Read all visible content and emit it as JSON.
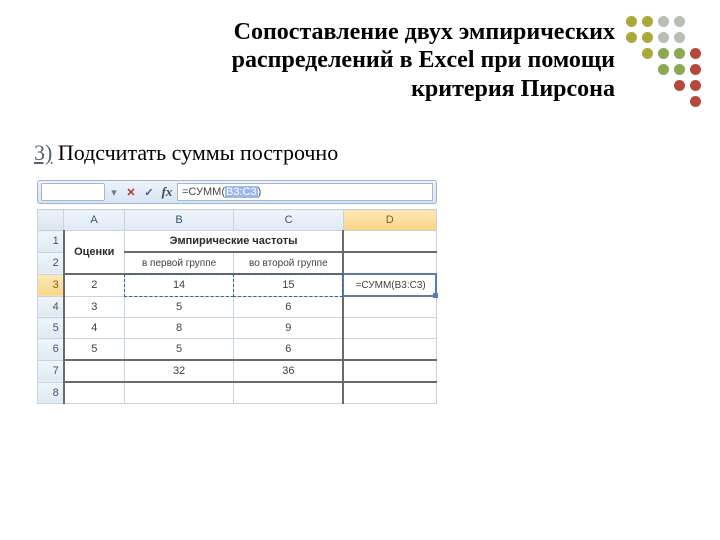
{
  "title": {
    "line1": "Сопоставление двух эмпирических",
    "line2": "распределений в Excel при помощи",
    "line3": "критерия Пирсона"
  },
  "step": {
    "num": "3)",
    "text": " Подсчитать  суммы построчно"
  },
  "fbar": {
    "cancel": "✕",
    "enter": "✓",
    "fx": "fx",
    "formula_prefix": "=СУММ(",
    "formula_sel": "B3:C3",
    "formula_suffix": ")"
  },
  "cols": {
    "a": "A",
    "b": "B",
    "c": "C",
    "d": "D"
  },
  "rows": [
    "1",
    "2",
    "3",
    "4",
    "5",
    "6",
    "7",
    "8"
  ],
  "hdr": {
    "a1": "Оценки",
    "bc1": "Эмпирические частоты",
    "b2": "в первой группе",
    "c2": "во второй группе"
  },
  "d3_formula": "=СУММ(B3:C3)",
  "chart_data": {
    "type": "table",
    "title": "Эмпирические частоты",
    "categories": [
      "Оценки",
      "в первой группе",
      "во второй группе"
    ],
    "rows": [
      {
        "a": 2,
        "b": 14,
        "c": 15
      },
      {
        "a": 3,
        "b": 5,
        "c": 6
      },
      {
        "a": 4,
        "b": 8,
        "c": 9
      },
      {
        "a": 5,
        "b": 5,
        "c": 6
      },
      {
        "a": "",
        "b": 32,
        "c": 36
      }
    ]
  },
  "deco_colors": {
    "olive": "#a9a93a",
    "gray": "#b7bfb0",
    "green": "#8aa84e",
    "red": "#b34a3a"
  }
}
